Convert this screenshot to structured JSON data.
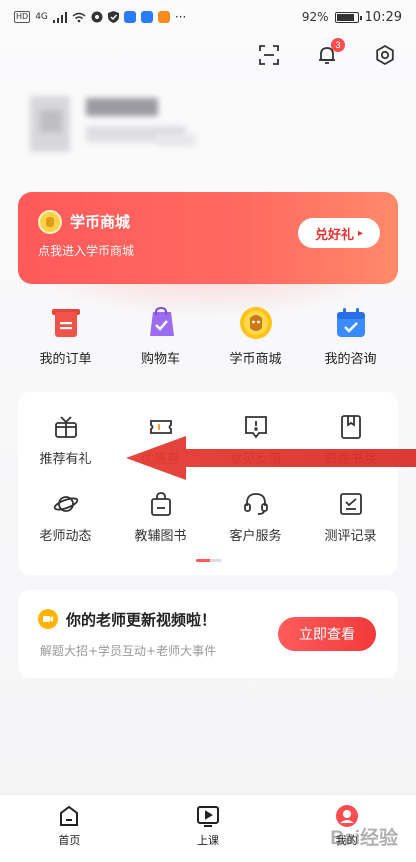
{
  "status_bar": {
    "network_chip": "HD",
    "signal": "4G",
    "more": "···",
    "battery_pct": "92%",
    "time": "10:29"
  },
  "header": {
    "notification_count": "3"
  },
  "banner": {
    "title": "学币商城",
    "subtitle": "点我进入学币商城",
    "button_label": "兑好礼",
    "button_arrow": "▸"
  },
  "quick_items": [
    {
      "label": "我的订单",
      "icon": "order-icon"
    },
    {
      "label": "购物车",
      "icon": "cart-icon"
    },
    {
      "label": "学币商城",
      "icon": "coin-mall-icon"
    },
    {
      "label": "我的咨询",
      "icon": "consult-icon"
    }
  ],
  "services": [
    {
      "label": "推荐有礼",
      "icon": "gift-icon"
    },
    {
      "label": "优惠券",
      "icon": "coupon-icon"
    },
    {
      "label": "意见反馈",
      "icon": "feedback-icon"
    },
    {
      "label": "高途书院",
      "icon": "book-icon"
    },
    {
      "label": "老师动态",
      "icon": "planet-icon"
    },
    {
      "label": "教辅图书",
      "icon": "bag-icon"
    },
    {
      "label": "客户服务",
      "icon": "headset-icon"
    },
    {
      "label": "测评记录",
      "icon": "record-icon"
    }
  ],
  "video_card": {
    "title": "你的老师更新视频啦！",
    "subtitle": "解题大招+学员互动+老师大事件",
    "button_label": "立即查看"
  },
  "tabs": [
    {
      "label": "首页",
      "icon": "home-icon"
    },
    {
      "label": "上课",
      "icon": "play-icon"
    },
    {
      "label": "我的",
      "icon": "profile-icon"
    }
  ],
  "watermark": "Bai经验",
  "colors": {
    "accent": "#ff5a5a",
    "button_text": "#e5312f",
    "arrow": "#e53a33"
  }
}
